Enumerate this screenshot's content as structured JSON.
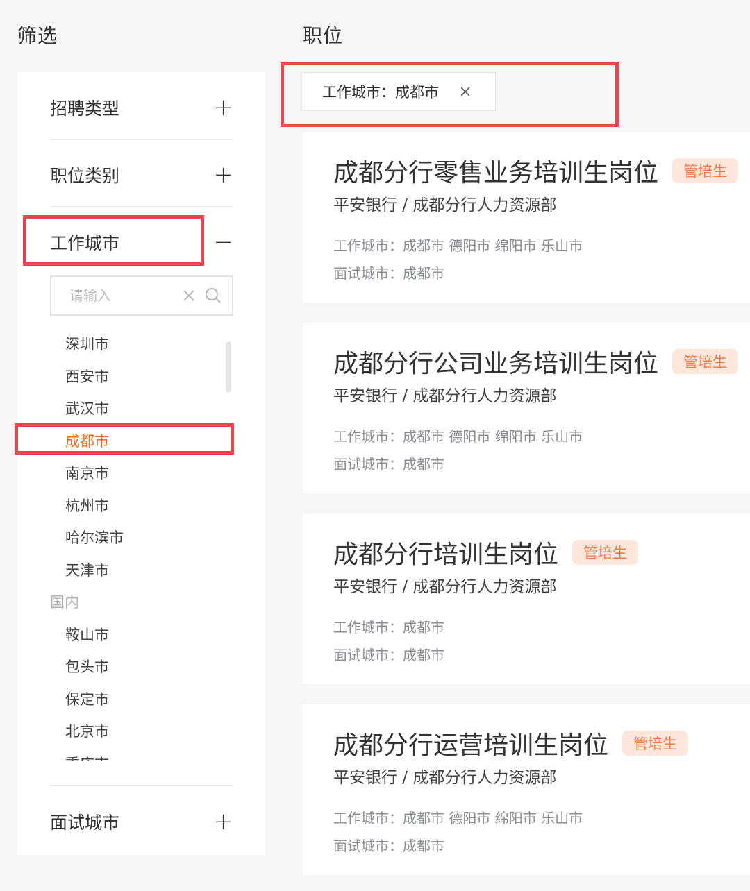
{
  "page": {
    "filter_title": "筛选",
    "jobs_title": "职位"
  },
  "sidebar": {
    "groups": [
      {
        "label": "招聘类型",
        "toggle": "+"
      },
      {
        "label": "职位类别",
        "toggle": "+"
      },
      {
        "label": "工作城市",
        "toggle": "−"
      },
      {
        "label": "面试城市",
        "toggle": "+"
      }
    ],
    "search": {
      "placeholder": "请输入",
      "value": ""
    },
    "cities": [
      {
        "label": "深圳市"
      },
      {
        "label": "西安市"
      },
      {
        "label": "武汉市"
      },
      {
        "label": "成都市",
        "selected": true
      },
      {
        "label": "南京市"
      },
      {
        "label": "杭州市"
      },
      {
        "label": "哈尔滨市"
      },
      {
        "label": "天津市"
      },
      {
        "label": "国内",
        "is_group": true
      },
      {
        "label": "鞍山市"
      },
      {
        "label": "包头市"
      },
      {
        "label": "保定市"
      },
      {
        "label": "北京市"
      },
      {
        "label": "重庆市"
      }
    ]
  },
  "filter_tag": {
    "label": "工作城市：成都市"
  },
  "jobs": [
    {
      "title": "成都分行零售业务培训生岗位",
      "badge": "管培生",
      "dept": "平安银行 / 成都分行人力资源部",
      "work_city": "工作城市：成都市 德阳市 绵阳市 乐山市",
      "interview_city": "面试城市：成都市"
    },
    {
      "title": "成都分行公司业务培训生岗位",
      "badge": "管培生",
      "dept": "平安银行 / 成都分行人力资源部",
      "work_city": "工作城市：成都市 德阳市 绵阳市 乐山市",
      "interview_city": "面试城市：成都市"
    },
    {
      "title": "成都分行培训生岗位",
      "badge": "管培生",
      "dept": "平安银行 / 成都分行人力资源部",
      "work_city": "工作城市：成都市",
      "interview_city": "面试城市：成都市"
    },
    {
      "title": "成都分行运营培训生岗位",
      "badge": "管培生",
      "dept": "平安银行 / 成都分行人力资源部",
      "work_city": "工作城市：成都市 德阳市 绵阳市 乐山市",
      "interview_city": "面试城市：成都市"
    }
  ],
  "colors": {
    "accent_orange": "#f26b21",
    "badge_bg": "#fde6dc",
    "highlight_red": "#e9454f"
  }
}
